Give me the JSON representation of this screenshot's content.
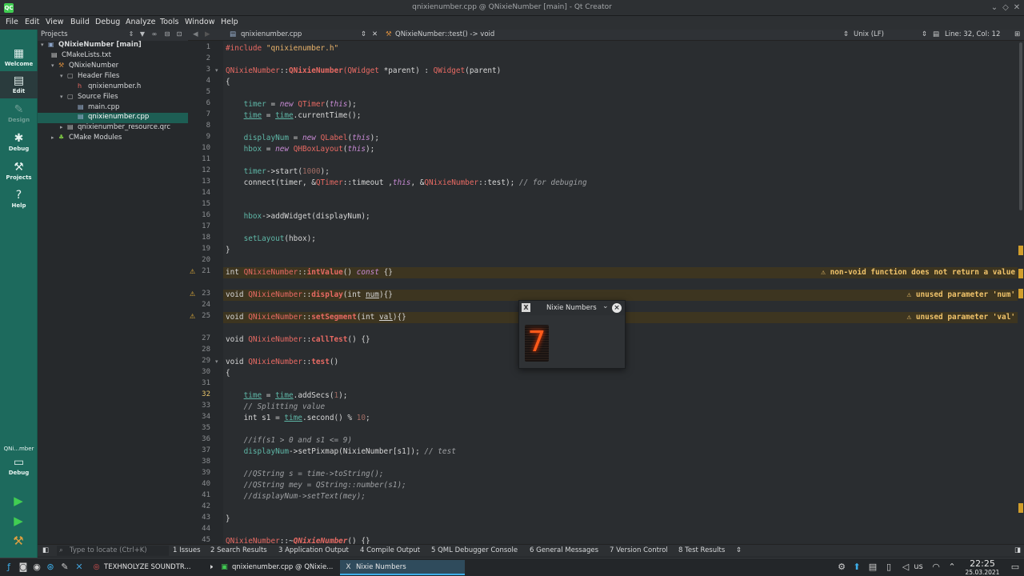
{
  "window": {
    "title": "qnixienumber.cpp @ QNixieNumber [main] - Qt Creator"
  },
  "menu": [
    "File",
    "Edit",
    "View",
    "Build",
    "Debug",
    "Analyze",
    "Tools",
    "Window",
    "Help"
  ],
  "modes": [
    {
      "label": "Welcome",
      "icon": "grid-icon"
    },
    {
      "label": "Edit",
      "icon": "edit-icon"
    },
    {
      "label": "Design",
      "icon": "design-icon"
    },
    {
      "label": "Debug",
      "icon": "bug-icon"
    },
    {
      "label": "Projects",
      "icon": "wrench-icon"
    },
    {
      "label": "Help",
      "icon": "help-icon"
    }
  ],
  "kit": {
    "label": "QNi...mber",
    "mode": "Debug"
  },
  "sidebar": {
    "header": "Projects",
    "tree": [
      {
        "label": "QNixieNumber [main]"
      },
      {
        "label": "CMakeLists.txt"
      },
      {
        "label": "QNixieNumber"
      },
      {
        "label": "Header Files"
      },
      {
        "label": "qnixienumber.h"
      },
      {
        "label": "Source Files"
      },
      {
        "label": "main.cpp"
      },
      {
        "label": "qnixienumber.cpp"
      },
      {
        "label": "qnixienumber_resource.qrc"
      },
      {
        "label": "CMake Modules"
      }
    ]
  },
  "editor": {
    "file": "qnixienumber.cpp",
    "symbol": "QNixieNumber::test() -> void",
    "encoding": "Unix (LF)",
    "position": "Line: 32, Col: 12",
    "line_numbers": [
      "1",
      "2",
      "3",
      "4",
      "5",
      "6",
      "7",
      "8",
      "9",
      "10",
      "11",
      "12",
      "13",
      "14",
      "15",
      "16",
      "17",
      "18",
      "19",
      "20",
      "21",
      "23",
      "24",
      "25",
      "27",
      "28",
      "29",
      "30",
      "31",
      "32",
      "33",
      "34",
      "35",
      "36",
      "37",
      "38",
      "39",
      "40",
      "41",
      "42",
      "43",
      "44",
      "45"
    ],
    "warnings": [
      "non-void function does not return a value",
      "unused parameter 'num'",
      "unused parameter 'val'"
    ]
  },
  "popup": {
    "title": "Nixie Numbers",
    "digit": "7"
  },
  "statusbar": {
    "locate_placeholder": "Type to locate (Ctrl+K)",
    "tabs": [
      "1 Issues",
      "2 Search Results",
      "3 Application Output",
      "4 Compile Output",
      "5 QML Debugger Console",
      "6 General Messages",
      "7 Version Control",
      "8 Test Results"
    ]
  },
  "taskbar": {
    "tasks": [
      "TEXHNOLYZE SOUNDTR...",
      "qnixienumber.cpp @ QNixie...",
      "Nixie Numbers"
    ],
    "layout": "us",
    "time": "22:25",
    "date": "25.03.2021"
  },
  "colors": {
    "accent": "#1d6a5d",
    "warning": "#f0c36a",
    "nixie": "#ff5a1a"
  }
}
